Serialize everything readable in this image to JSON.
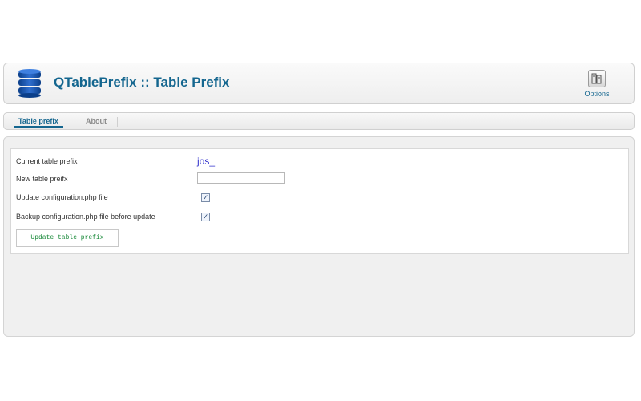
{
  "header": {
    "title": "QTablePrefix :: Table Prefix",
    "logo_icon": "database-icon",
    "options": {
      "label": "Options",
      "icon": "options-icon"
    }
  },
  "tabs": [
    {
      "label": "Table prefix",
      "active": true
    },
    {
      "label": "About",
      "active": false
    }
  ],
  "form": {
    "current_prefix": {
      "label": "Current table prefix",
      "value": "jos_"
    },
    "new_prefix": {
      "label": "New table preifx",
      "value": ""
    },
    "update_config": {
      "label": "Update configuration.php file",
      "checked": true
    },
    "backup_config": {
      "label": "Backup configuration.php file before update",
      "checked": true
    },
    "submit_label": "Update table prefix"
  },
  "colors": {
    "accent": "#14668f",
    "prefix_value": "#3333cc",
    "button_text": "#1a8a3a"
  }
}
